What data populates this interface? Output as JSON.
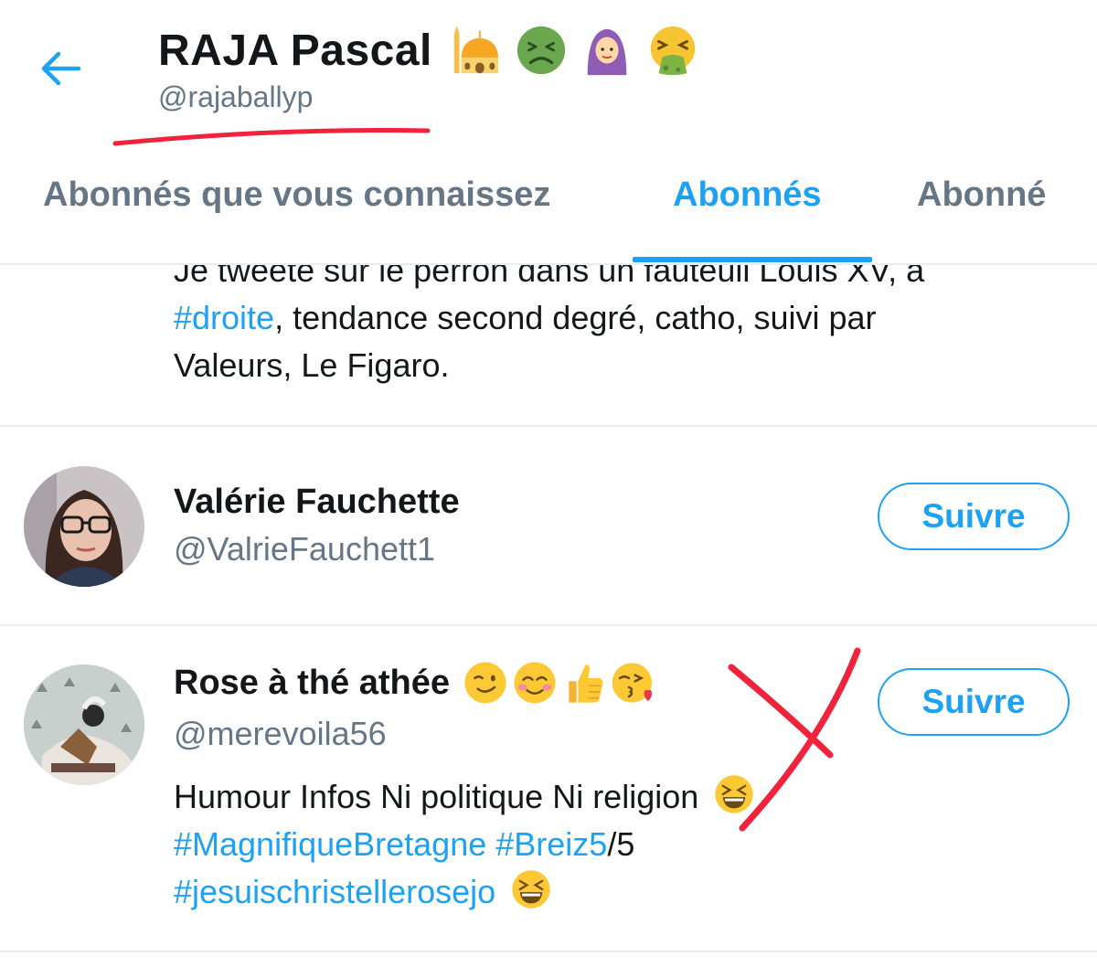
{
  "header": {
    "title": "RAJA Pascal",
    "handle": "@rajaballyp",
    "title_emojis": [
      "mosque-icon",
      "nauseated-face-icon",
      "woman-with-headscarf-icon",
      "vomiting-face-icon"
    ]
  },
  "tabs": [
    {
      "label": "Abonnés que vous connaissez",
      "active": false
    },
    {
      "label": "Abonnés",
      "active": true
    },
    {
      "label": "Abonné",
      "active": false
    }
  ],
  "partial_bio": {
    "line1": "Je tweete sur le perron dans un fauteuil Louis XV, à",
    "hashtag": "#droite",
    "rest": ", tendance second degré, catho, suivi par",
    "line3": "Valeurs, Le Figaro."
  },
  "users": [
    {
      "name": "Valérie Fauchette",
      "handle": "@ValrieFauchett1",
      "button_label": "Suivre"
    },
    {
      "name": "Rose à thé athée",
      "name_emojis": [
        "winking-face-icon",
        "smiling-face-icon",
        "thumbs-up-icon",
        "face-blowing-kiss-icon"
      ],
      "handle": "@merevoila56",
      "button_label": "Suivre",
      "bio_text": "Humour Infos Ni politique Ni religion",
      "bio_tag1": "#MagnifiqueBretagne",
      "bio_tag2": "#Breiz5",
      "bio_tag2_suffix": "/5",
      "bio_tag3": "#jesuischristellerosejo"
    }
  ],
  "colors": {
    "accent": "#1da1f2",
    "secondary_text": "#657786",
    "primary_text": "#14171a",
    "divider": "#e6ecf0",
    "annotation": "#f0223c"
  }
}
